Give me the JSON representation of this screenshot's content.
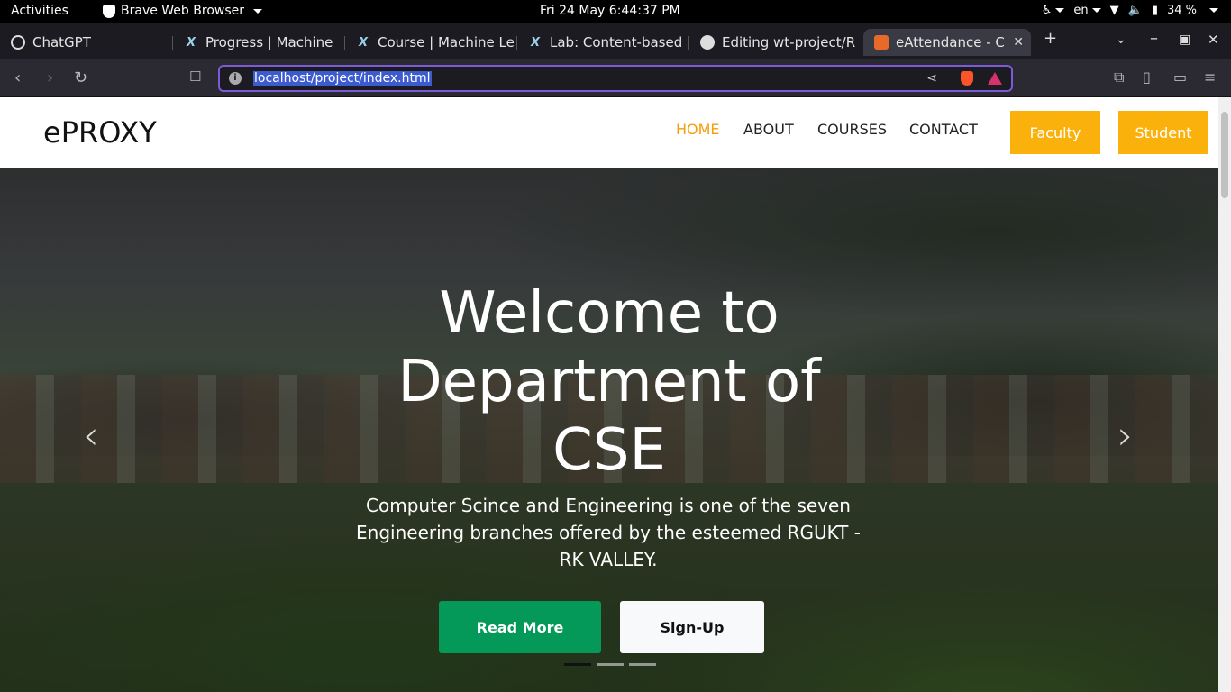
{
  "system_bar": {
    "activities": "Activities",
    "app_name": "Brave Web Browser",
    "clock": "Fri 24 May   6:44:37 PM",
    "lang": "en",
    "battery": "34 %"
  },
  "tabs": [
    {
      "label": "ChatGPT",
      "icon": "chatgpt-icon"
    },
    {
      "label": "Progress | Machine",
      "icon": "edx-icon"
    },
    {
      "label": "Course | Machine Le",
      "icon": "edx-icon"
    },
    {
      "label": "Lab: Content-based",
      "icon": "edx-icon"
    },
    {
      "label": "Editing wt-project/R",
      "icon": "github-icon"
    },
    {
      "label": "eAttendance - C",
      "icon": "eattendance-icon"
    }
  ],
  "address_bar": {
    "url": "localhost/project/index.html"
  },
  "site": {
    "brand": "ePROXY",
    "nav": [
      "HOME",
      "ABOUT",
      "COURSES",
      "CONTACT"
    ],
    "faculty_button": "Faculty",
    "student_button": "Student",
    "hero": {
      "title": "Welcome to Department of CSE",
      "subtitle": "Computer Scince and Engineering is one of the seven Engineering branches offered by the esteemed RGUKT - RK VALLEY.",
      "read_more": "Read More",
      "sign_up": "Sign-Up"
    }
  },
  "colors": {
    "accent_orange": "#fbb10c",
    "nav_active": "#f59e0b",
    "read_more_green": "#049859",
    "omnibox_border": "#7b5cd6"
  }
}
